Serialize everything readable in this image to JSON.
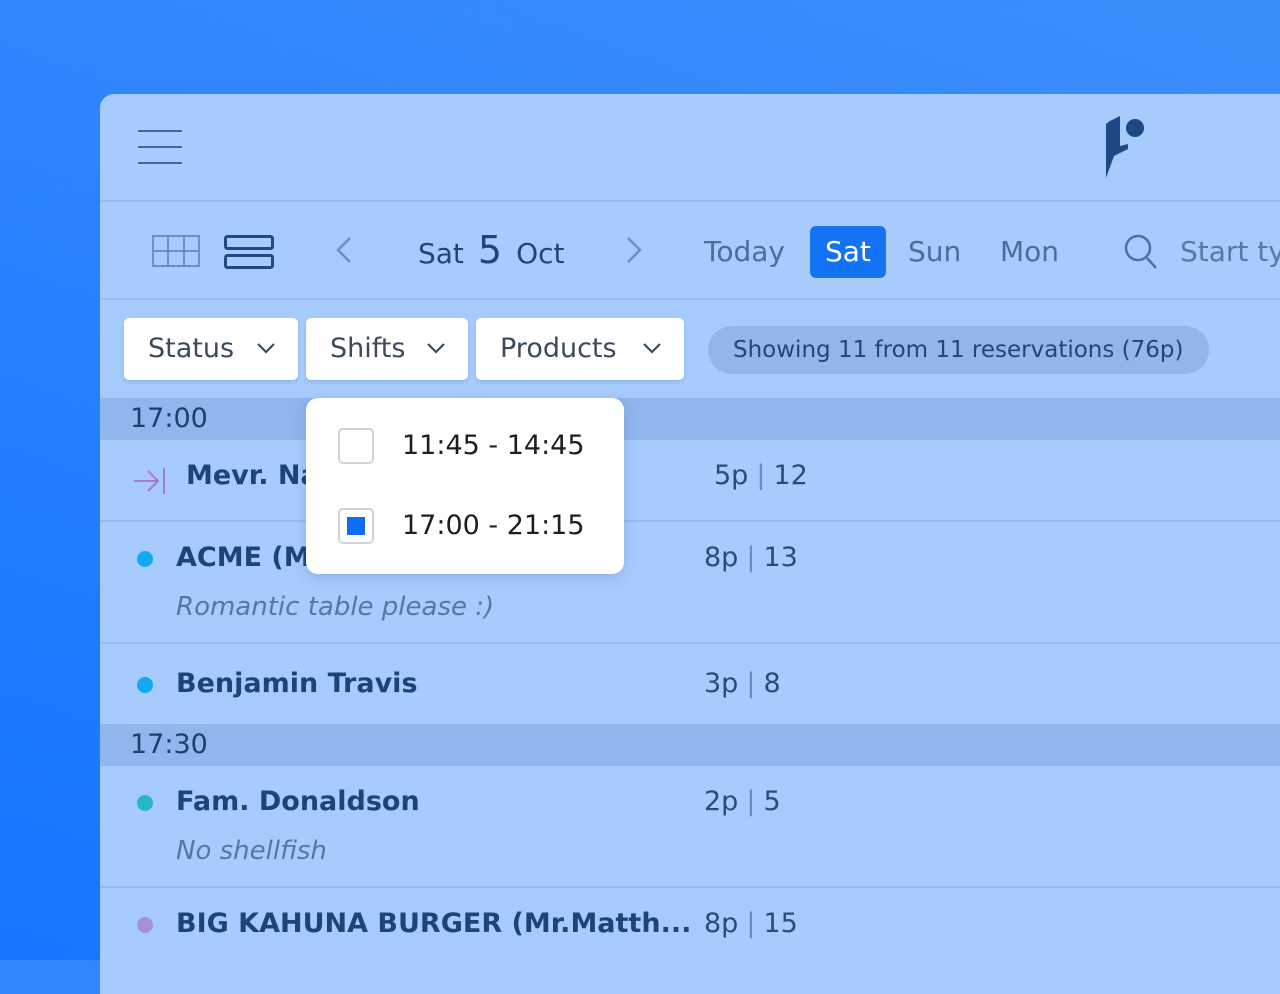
{
  "toolbar": {
    "date_weekday": "Sat",
    "date_day": "5",
    "date_month": "Oct",
    "day_buttons": [
      "Today",
      "Sat",
      "Sun",
      "Mon"
    ],
    "active_day": "Sat",
    "search_placeholder": "Start ty"
  },
  "filters": {
    "status": "Status",
    "shifts": "Shifts",
    "products": "Products",
    "summary": "Showing 11 from 11 reservations (76p)"
  },
  "shifts_dropdown": {
    "options": [
      {
        "label": "11:45 - 14:45",
        "checked": false
      },
      {
        "label": "17:00 - 21:15",
        "checked": true
      }
    ]
  },
  "sections": [
    {
      "time": "17:00",
      "reservations": [
        {
          "name": "Mevr. Na",
          "note": "",
          "persons": "5p",
          "table": "12",
          "icon": "arrival-arrow-icon"
        },
        {
          "name": "ACME (Mr",
          "note": "Romantic table please :)",
          "persons": "8p",
          "table": "13",
          "dot_color": "#13a8f2"
        },
        {
          "name": "Benjamin Travis",
          "note": "",
          "persons": "3p",
          "table": "8",
          "dot_color": "#13a8f2"
        }
      ]
    },
    {
      "time": "17:30",
      "reservations": [
        {
          "name": "Fam. Donaldson",
          "note": "No shellfish",
          "persons": "2p",
          "table": "5",
          "dot_color": "#27b5c9"
        },
        {
          "name": "BIG KAHUNA BURGER (Mr.Matth...",
          "note": "",
          "persons": "8p",
          "table": "15",
          "dot_color": "#a88fd9"
        }
      ]
    }
  ],
  "colors": {
    "accent": "#1473f5",
    "panel": "#a8cbfd",
    "section": "#8fb6ed"
  }
}
